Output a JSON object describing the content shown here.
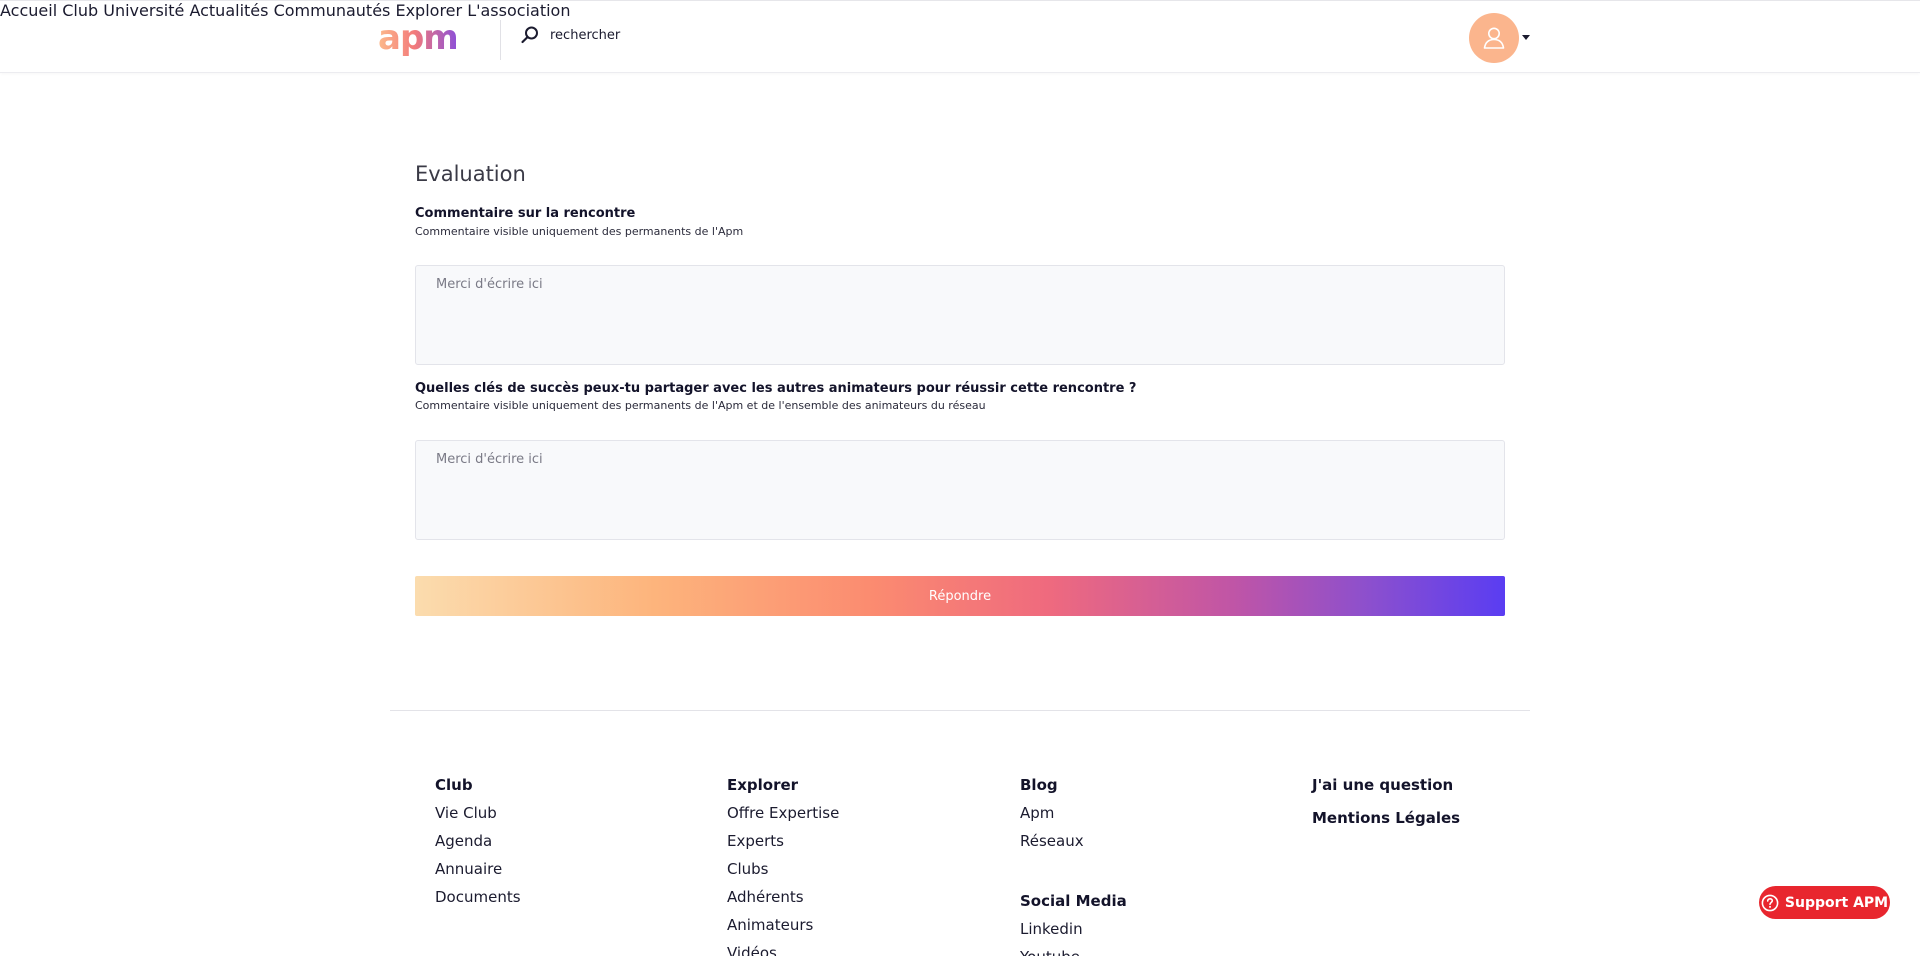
{
  "header": {
    "logo_text": "apm",
    "search_placeholder": "rechercher",
    "nav": [
      "Accueil",
      "Club",
      "Université",
      "Actualités",
      "Communautés",
      "Explorer",
      "L'association"
    ]
  },
  "form": {
    "title": "Evaluation",
    "q1_label": "Commentaire sur la rencontre",
    "q1_help": "Commentaire visible uniquement des permanents de l'Apm",
    "q1_placeholder": "Merci d'écrire ici",
    "q2_label": "Quelles clés de succès peux-tu partager avec les autres animateurs pour réussir cette rencontre ?",
    "q2_help": "Commentaire visible uniquement des permanents de l'Apm et de l'ensemble des animateurs du réseau",
    "q2_placeholder": "Merci d'écrire ici",
    "submit_label": "Répondre"
  },
  "footer": {
    "club": {
      "title": "Club",
      "links": [
        "Vie Club",
        "Agenda",
        "Annuaire",
        "Documents"
      ]
    },
    "explorer": {
      "title": "Explorer",
      "links": [
        "Offre Expertise",
        "Experts",
        "Clubs",
        "Adhérents",
        "Animateurs",
        "Vidéos"
      ]
    },
    "blog": {
      "title": "Blog",
      "links": [
        "Apm",
        "Réseaux"
      ]
    },
    "social": {
      "title": "Social Media",
      "links": [
        "Linkedin",
        "Youtube"
      ]
    },
    "misc": {
      "question": "J'ai une question",
      "legal": "Mentions Légales"
    }
  },
  "support_label": "Support APM",
  "colors": {
    "avatar_bg": "#fbb58d",
    "support_bg": "#e8262e",
    "gradient_end": "#5a3df2"
  }
}
